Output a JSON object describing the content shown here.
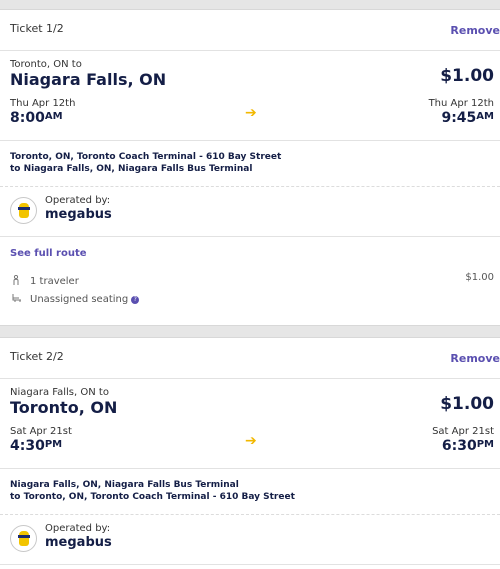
{
  "tickets": [
    {
      "label": "Ticket 1/2",
      "remove": "Remove",
      "origin_small": "Toronto, ON to",
      "destination": "Niagara Falls, ON",
      "price": "$1.00",
      "depart_date": "Thu Apr 12th",
      "depart_time": "8:00",
      "depart_ampm": "AM",
      "arrive_date": "Thu Apr 12th",
      "arrive_time": "9:45",
      "arrive_ampm": "AM",
      "route_from": "Toronto, ON, Toronto Coach Terminal - 610 Bay Street",
      "route_to": "to   Niagara Falls, ON, Niagara Falls Bus Terminal",
      "operated_by": "Operated by:",
      "operator": "megabus",
      "see_full_route": "See full route",
      "travelers": "1 traveler",
      "travelers_price": "$1.00",
      "seating": "Unassigned seating"
    },
    {
      "label": "Ticket 2/2",
      "remove": "Remove",
      "origin_small": "Niagara Falls, ON to",
      "destination": "Toronto, ON",
      "price": "$1.00",
      "depart_date": "Sat Apr 21st",
      "depart_time": "4:30",
      "depart_ampm": "PM",
      "arrive_date": "Sat Apr 21st",
      "arrive_time": "6:30",
      "arrive_ampm": "PM",
      "route_from": "Niagara Falls, ON, Niagara Falls Bus Terminal",
      "route_to": "to   Toronto, ON, Toronto Coach Terminal - 610 Bay Street",
      "operated_by": "Operated by:",
      "operator": "megabus"
    }
  ],
  "icons": {
    "arrow": "right-arrow-icon",
    "traveler": "person-icon",
    "seat": "seat-icon",
    "help": "help-icon"
  },
  "colors": {
    "accent": "#5a4fb0",
    "arrow": "#f2b800",
    "navy": "#141e46"
  }
}
